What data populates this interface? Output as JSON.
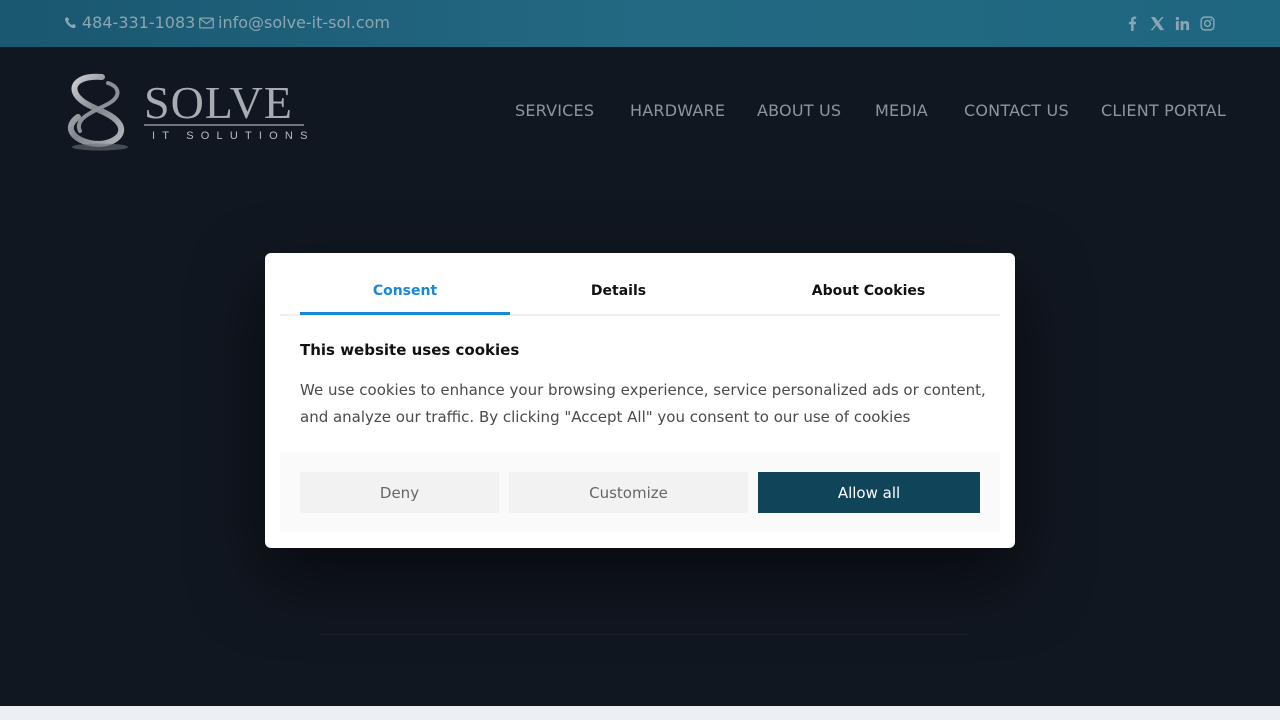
{
  "topbar": {
    "phone": "484-331-1083",
    "email": "info@solve-it-sol.com",
    "social_icons": [
      "facebook-icon",
      "x-icon",
      "linkedin-icon",
      "instagram-icon"
    ]
  },
  "logo": {
    "word": "SOLVE",
    "tagline": "IT SOLUTIONS"
  },
  "nav": [
    "SERVICES",
    "HARDWARE",
    "ABOUT US",
    "MEDIA",
    "CONTACT US",
    "CLIENT PORTAL"
  ],
  "cookie_dialog": {
    "tabs": [
      "Consent",
      "Details",
      "About Cookies"
    ],
    "active_tab": "Consent",
    "title": "This website uses cookies",
    "body": "We use cookies to enhance your browsing experience, service personalized ads or content, and analyze our traffic. By clicking \"Accept All\" you consent to our use of cookies",
    "buttons": {
      "deny": "Deny",
      "customize": "Customize",
      "allow": "Allow all"
    }
  },
  "colors": {
    "topbar": "#1f6680",
    "page_bg": "#111720",
    "accent_blue": "#1a88d4",
    "allow_button": "#0f4459"
  }
}
